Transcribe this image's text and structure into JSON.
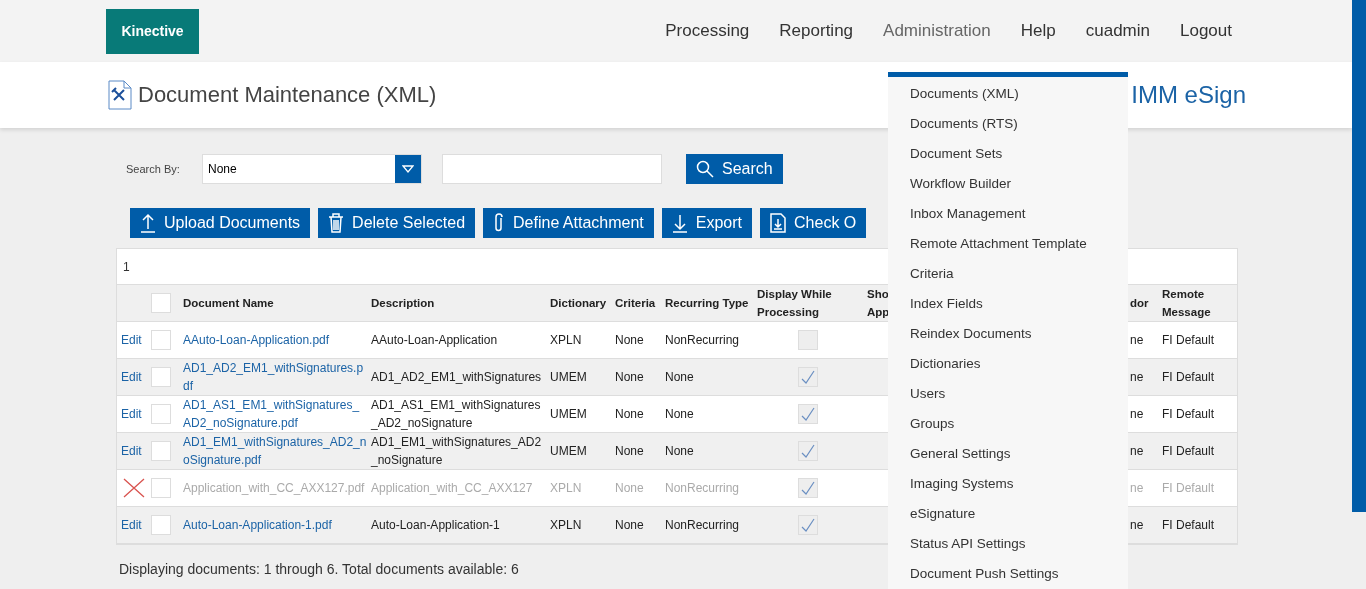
{
  "logo": "Kinective",
  "nav": [
    {
      "label": "Processing",
      "selected": false
    },
    {
      "label": "Reporting",
      "selected": false
    },
    {
      "label": "Administration",
      "selected": true
    },
    {
      "label": "Help",
      "selected": false
    },
    {
      "label": "cuadmin",
      "selected": false
    },
    {
      "label": "Logout",
      "selected": false
    }
  ],
  "page_title": "Document Maintenance (XML)",
  "product_name": "IMM eSign",
  "search": {
    "label": "Search By:",
    "select_value": "None",
    "button": "Search"
  },
  "toolbar": [
    {
      "label": "Upload Documents",
      "kind": "upload"
    },
    {
      "label": "Delete Selected",
      "kind": "delete"
    },
    {
      "label": "Define Attachment",
      "kind": "attach"
    },
    {
      "label": "Export",
      "kind": "export"
    },
    {
      "label": "Check O",
      "kind": "checkout"
    }
  ],
  "pager": "1",
  "table": {
    "select_all": false,
    "columns": [
      "Document Name",
      "Description",
      "Dictionary",
      "Criteria",
      "Recurring Type",
      "Display While Processing",
      "Sho App",
      "dor",
      "Remote Message"
    ],
    "rows": [
      {
        "edit": "Edit",
        "deleted": false,
        "selected": false,
        "name": "AAuto-Loan-Application.pdf",
        "description": "AAuto-Loan-Application",
        "dictionary": "XPLN",
        "criteria": "None",
        "recurring_type": "NonRecurring",
        "display_while_processing": false,
        "column_10": "ne",
        "remote_message": "FI Default"
      },
      {
        "edit": "Edit",
        "deleted": false,
        "selected": false,
        "name": "AD1_AD2_EM1_withSignatures.pdf",
        "description": "AD1_AD2_EM1_withSignatures",
        "dictionary": "UMEM",
        "criteria": "None",
        "recurring_type": "None",
        "display_while_processing": true,
        "column_10": "ne",
        "remote_message": "FI Default"
      },
      {
        "edit": "Edit",
        "deleted": false,
        "selected": false,
        "name": "AD1_AS1_EM1_withSignatures_AD2_noSignature.pdf",
        "description": "AD1_AS1_EM1_withSignatures_AD2_noSignature",
        "dictionary": "UMEM",
        "criteria": "None",
        "recurring_type": "None",
        "display_while_processing": true,
        "column_10": "ne",
        "remote_message": "FI Default"
      },
      {
        "edit": "Edit",
        "deleted": false,
        "selected": false,
        "name": "AD1_EM1_withSignatures_AD2_noSignature.pdf",
        "description": "AD1_EM1_withSignatures_AD2_noSignature",
        "dictionary": "UMEM",
        "criteria": "None",
        "recurring_type": "None",
        "display_while_processing": true,
        "column_10": "ne",
        "remote_message": "FI Default"
      },
      {
        "deleted": true,
        "selected": false,
        "name": "Application_with_CC_AXX127.pdf",
        "description": "Application_with_CC_AXX127",
        "dictionary": "XPLN",
        "criteria": "None",
        "recurring_type": "NonRecurring",
        "display_while_processing": true,
        "column_10": "ne",
        "remote_message": "FI Default"
      },
      {
        "edit": "Edit",
        "deleted": false,
        "selected": false,
        "name": "Auto-Loan-Application-1.pdf",
        "description": "Auto-Loan-Application-1",
        "dictionary": "XPLN",
        "criteria": "None",
        "recurring_type": "NonRecurring",
        "display_while_processing": true,
        "column_10": "ne",
        "remote_message": "FI Default"
      }
    ]
  },
  "status": "Displaying documents: 1 through 6. Total documents available: 6",
  "menu": [
    {
      "label": "Documents (XML)"
    },
    {
      "label": "Documents (RTS)"
    },
    {
      "label": "Document Sets"
    },
    {
      "label": "Workflow Builder"
    },
    {
      "label": "Inbox Management"
    },
    {
      "label": "Remote Attachment Template"
    },
    {
      "label": "Criteria"
    },
    {
      "label": "Index Fields"
    },
    {
      "label": "Reindex Documents"
    },
    {
      "label": "Dictionaries"
    },
    {
      "label": "Users"
    },
    {
      "label": "Groups"
    },
    {
      "label": "General Settings"
    },
    {
      "label": "Imaging Systems"
    },
    {
      "label": "eSignature"
    },
    {
      "label": "Status API Settings"
    },
    {
      "label": "Document Push Settings"
    }
  ]
}
